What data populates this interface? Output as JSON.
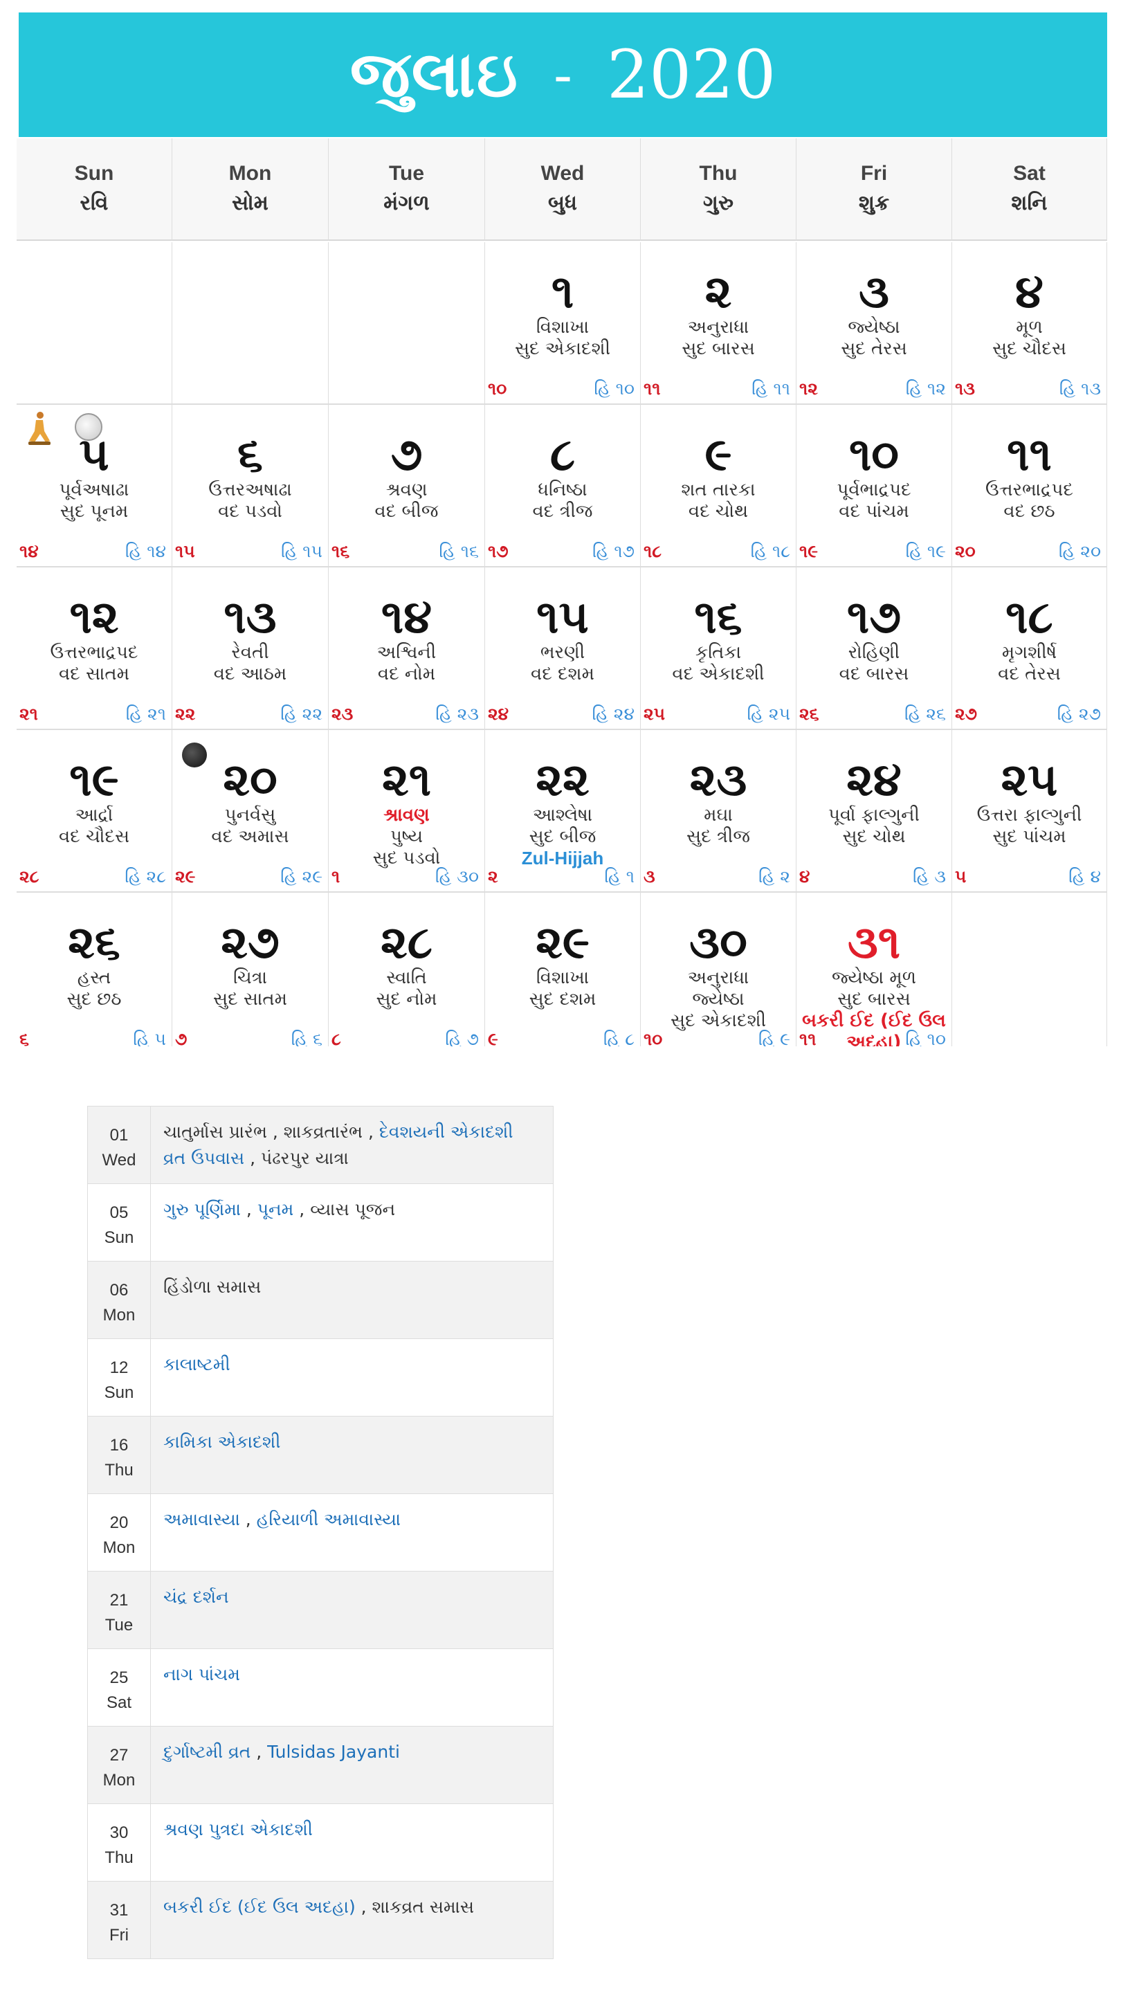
{
  "header": {
    "month": "જુલાઇ",
    "separator": "-",
    "year": "2020"
  },
  "weekdays": [
    {
      "en": "Sun",
      "gu": "રવિ"
    },
    {
      "en": "Mon",
      "gu": "સોમ"
    },
    {
      "en": "Tue",
      "gu": "મંગળ"
    },
    {
      "en": "Wed",
      "gu": "બુધ"
    },
    {
      "en": "Thu",
      "gu": "ગુરુ"
    },
    {
      "en": "Fri",
      "gu": "શુક્ર"
    },
    {
      "en": "Sat",
      "gu": "શનિ"
    }
  ],
  "weeks": [
    [
      null,
      null,
      null,
      {
        "day": "૧",
        "l1": "વિશાખા",
        "l2": "સુદ એકાદશી",
        "fl": "૧૦",
        "fr": "હિ ૧૦"
      },
      {
        "day": "૨",
        "l1": "અનુરાધા",
        "l2": "સુદ બારસ",
        "fl": "૧૧",
        "fr": "હિ ૧૧"
      },
      {
        "day": "૩",
        "l1": "જ્યેષ્ઠા",
        "l2": "સુદ તેરસ",
        "fl": "૧૨",
        "fr": "હિ ૧૨"
      },
      {
        "day": "૪",
        "l1": "મૂળ",
        "l2": "સુદ ચૌદસ",
        "fl": "૧૩",
        "fr": "હિ ૧૩"
      }
    ],
    [
      {
        "day": "૫",
        "l1": "પૂર્વઅષાઢા",
        "l2": "સુદ પૂનમ",
        "fl": "૧૪",
        "fr": "હિ ૧૪",
        "icons": [
          "yoga-icon",
          "full-moon-icon"
        ]
      },
      {
        "day": "૬",
        "l1": "ઉત્તરઅષાઢા",
        "l2": "વદ પડવો",
        "fl": "૧૫",
        "fr": "હિ ૧૫"
      },
      {
        "day": "૭",
        "l1": "શ્રવણ",
        "l2": "વદ બીજ",
        "fl": "૧૬",
        "fr": "હિ ૧૬"
      },
      {
        "day": "૮",
        "l1": "ધનિષ્ઠા",
        "l2": "વદ ત્રીજ",
        "fl": "૧૭",
        "fr": "હિ ૧૭"
      },
      {
        "day": "૯",
        "l1": "શત તારકા",
        "l2": "વદ ચોથ",
        "fl": "૧૮",
        "fr": "હિ ૧૮"
      },
      {
        "day": "૧૦",
        "l1": "પૂર્વભાદ્રપદ",
        "l2": "વદ પાંચમ",
        "fl": "૧૯",
        "fr": "હિ ૧૯"
      },
      {
        "day": "૧૧",
        "l1": "ઉત્તરભાદ્રપદ",
        "l2": "વદ છઠ",
        "fl": "૨૦",
        "fr": "હિ ૨૦"
      }
    ],
    [
      {
        "day": "૧૨",
        "l1": "ઉત્તરભાદ્રપદ",
        "l2": "વદ સાતમ",
        "fl": "૨૧",
        "fr": "હિ ૨૧"
      },
      {
        "day": "૧૩",
        "l1": "રેવતી",
        "l2": "વદ આઠમ",
        "fl": "૨૨",
        "fr": "હિ ૨૨"
      },
      {
        "day": "૧૪",
        "l1": "અશ્વિની",
        "l2": "વદ નોમ",
        "fl": "૨૩",
        "fr": "હિ ૨૩"
      },
      {
        "day": "૧૫",
        "l1": "ભરણી",
        "l2": "વદ દશમ",
        "fl": "૨૪",
        "fr": "હિ ૨૪"
      },
      {
        "day": "૧૬",
        "l1": "કૃતિકા",
        "l2": "વદ એકાદશી",
        "fl": "૨૫",
        "fr": "હિ ૨૫"
      },
      {
        "day": "૧૭",
        "l1": "રોહિણી",
        "l2": "વદ બારસ",
        "fl": "૨૬",
        "fr": "હિ ૨૬"
      },
      {
        "day": "૧૮",
        "l1": "મૃગશીર્ષ",
        "l2": "વદ તેરસ",
        "fl": "૨૭",
        "fr": "હિ ૨૭"
      }
    ],
    [
      {
        "day": "૧૯",
        "l1": "આર્દ્રા",
        "l2": "વદ ચૌદસ",
        "fl": "૨૮",
        "fr": "હિ ૨૮"
      },
      {
        "day": "૨૦",
        "l1": "પુનર્વસુ",
        "l2": "વદ અમાસ",
        "fl": "૨૯",
        "fr": "હિ ૨૯",
        "icons": [
          "new-moon-icon"
        ]
      },
      {
        "day": "૨૧",
        "hl": "શ્રાવણ",
        "l1": "પુષ્ય",
        "l2": "સુદ પડવો",
        "fl": "૧",
        "fr": "હિ ૩૦"
      },
      {
        "day": "૨૨",
        "l1": "આશ્લેષા",
        "l2": "સુદ બીજ",
        "blue": "Zul-Hijjah",
        "fl": "૨",
        "fr": "હિ ૧"
      },
      {
        "day": "૨૩",
        "l1": "મઘા",
        "l2": "સુદ ત્રીજ",
        "fl": "૩",
        "fr": "હિ ૨"
      },
      {
        "day": "૨૪",
        "l1": "પૂર્વા ફાલ્ગુની",
        "l2": "સુદ ચોથ",
        "fl": "૪",
        "fr": "હિ ૩"
      },
      {
        "day": "૨૫",
        "l1": "ઉત્તરા ફાલ્ગુની",
        "l2": "સુદ પાંચમ",
        "fl": "૫",
        "fr": "હિ ૪"
      }
    ],
    [
      {
        "day": "૨૬",
        "l1": "હસ્ત",
        "l2": "સુદ છઠ",
        "fl": "૬",
        "fr": "હિ ૫"
      },
      {
        "day": "૨૭",
        "l1": "ચિત્રા",
        "l2": "સુદ સાતમ",
        "fl": "૭",
        "fr": "હિ ૬"
      },
      {
        "day": "૨૮",
        "l1": "સ્વાતિ",
        "l2": "સુદ નોમ",
        "fl": "૮",
        "fr": "હિ ૭"
      },
      {
        "day": "૨૯",
        "l1": "વિશાખા",
        "l2": "સુદ દશમ",
        "fl": "૯",
        "fr": "હિ ૮"
      },
      {
        "day": "૩૦",
        "l1": "અનુરાધા",
        "l2": "જ્યેષ્ઠા",
        "l3": "સુદ એકાદશી",
        "fl": "૧૦",
        "fr": "હિ ૯"
      },
      {
        "day": "૩૧",
        "dayRed": true,
        "l1": "જ્યેષ્ઠા મૂળ",
        "l2": "સુદ બારસ",
        "hl2": "બકરી ઈદ (ઈદ ઉલ અદહા)",
        "fl": "૧૧",
        "fr": "હિ ૧૦"
      },
      null
    ]
  ],
  "events": [
    {
      "date": "01",
      "dow": "Wed",
      "items": [
        {
          "t": "ચાતુર્માસ પ્રારંભ",
          "link": false
        },
        {
          "t": "શાકવ્રતારંભ",
          "link": false
        },
        {
          "t": "દેવશયની એકાદશી વ્રત ઉપવાસ",
          "link": true
        },
        {
          "t": "પંઢરપુર યાત્રા",
          "link": false
        }
      ]
    },
    {
      "date": "05",
      "dow": "Sun",
      "items": [
        {
          "t": "ગુરુ પૂર્ણિમા",
          "link": true
        },
        {
          "t": "પૂનમ",
          "link": true
        },
        {
          "t": "વ્યાસ પૂજન",
          "link": false
        }
      ]
    },
    {
      "date": "06",
      "dow": "Mon",
      "items": [
        {
          "t": "હિંડોળા સમાસ",
          "link": false
        }
      ]
    },
    {
      "date": "12",
      "dow": "Sun",
      "items": [
        {
          "t": "કાલાષ્ટમી",
          "link": true
        }
      ]
    },
    {
      "date": "16",
      "dow": "Thu",
      "items": [
        {
          "t": "કામિકા એકાદશી",
          "link": true
        }
      ]
    },
    {
      "date": "20",
      "dow": "Mon",
      "items": [
        {
          "t": "અમાવાસ્યા",
          "link": true
        },
        {
          "t": "હરિયાળી અમાવાસ્યા",
          "link": true
        }
      ]
    },
    {
      "date": "21",
      "dow": "Tue",
      "items": [
        {
          "t": "ચંદ્ર દર્શન",
          "link": true
        }
      ]
    },
    {
      "date": "25",
      "dow": "Sat",
      "items": [
        {
          "t": "નાગ પાંચમ",
          "link": true
        }
      ]
    },
    {
      "date": "27",
      "dow": "Mon",
      "items": [
        {
          "t": "દુર્ગાષ્ટમી વ્રત",
          "link": true
        },
        {
          "t": "Tulsidas Jayanti",
          "link": true
        }
      ]
    },
    {
      "date": "30",
      "dow": "Thu",
      "items": [
        {
          "t": "શ્રવણ પુત્રદા એકાદશી",
          "link": true
        }
      ]
    },
    {
      "date": "31",
      "dow": "Fri",
      "items": [
        {
          "t": "બકરી ઈદ (ઈદ ઉલ અદહા)",
          "link": true
        },
        {
          "t": "શાકવ્રત સમાસ",
          "link": false
        }
      ]
    }
  ],
  "colors": {
    "header_bg": "#26c6da",
    "red": "#e01e2a",
    "blue": "#2b8fd6",
    "link": "#1d6fb8"
  }
}
